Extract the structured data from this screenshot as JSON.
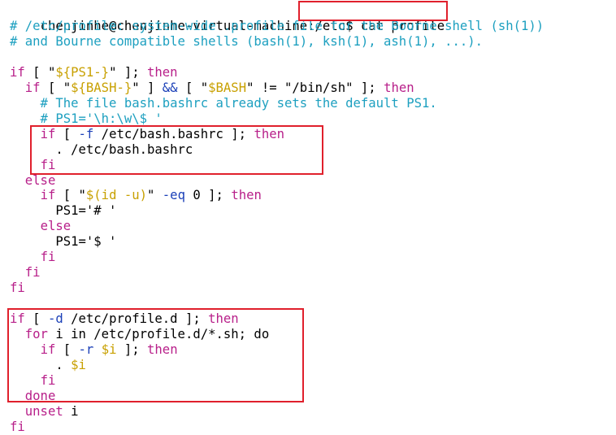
{
  "terminal": {
    "prompt": "chenjinhe@chenjinhe-virtual-machine:",
    "command": "/etc$ cat profile",
    "lines": [
      [
        {
          "t": "# /etc/profile: system-wide .profile file for the Bourne shell (sh(1))",
          "c": "cmt"
        }
      ],
      [
        {
          "t": "# and Bourne compatible shells (bash(1), ksh(1), ash(1), ...).",
          "c": "cmt"
        }
      ],
      [],
      [
        {
          "t": "if",
          "c": "kw"
        },
        {
          "t": " [ \"",
          "c": "txt"
        },
        {
          "t": "${PS1-}",
          "c": "var"
        },
        {
          "t": "\" ]; ",
          "c": "txt"
        },
        {
          "t": "then",
          "c": "kw"
        }
      ],
      [
        {
          "t": "  ",
          "c": "txt"
        },
        {
          "t": "if",
          "c": "kw"
        },
        {
          "t": " [ \"",
          "c": "txt"
        },
        {
          "t": "${BASH-}",
          "c": "var"
        },
        {
          "t": "\" ] ",
          "c": "txt"
        },
        {
          "t": "&&",
          "c": "op"
        },
        {
          "t": " [ \"",
          "c": "txt"
        },
        {
          "t": "$BASH",
          "c": "var"
        },
        {
          "t": "\" != \"/bin/sh\" ]; ",
          "c": "txt"
        },
        {
          "t": "then",
          "c": "kw"
        }
      ],
      [
        {
          "t": "    # The file bash.bashrc already sets the default PS1.",
          "c": "cmt"
        }
      ],
      [
        {
          "t": "    # PS1='\\h:\\w\\$ '",
          "c": "cmt"
        }
      ],
      [
        {
          "t": "    ",
          "c": "txt"
        },
        {
          "t": "if",
          "c": "kw"
        },
        {
          "t": " [ ",
          "c": "txt"
        },
        {
          "t": "-f",
          "c": "op"
        },
        {
          "t": " /etc/bash.bashrc ]; ",
          "c": "txt"
        },
        {
          "t": "then",
          "c": "kw"
        }
      ],
      [
        {
          "t": "      . /etc/bash.bashrc",
          "c": "txt"
        }
      ],
      [
        {
          "t": "    ",
          "c": "txt"
        },
        {
          "t": "fi",
          "c": "kw"
        }
      ],
      [
        {
          "t": "  ",
          "c": "txt"
        },
        {
          "t": "else",
          "c": "kw"
        }
      ],
      [
        {
          "t": "    ",
          "c": "txt"
        },
        {
          "t": "if",
          "c": "kw"
        },
        {
          "t": " [ \"",
          "c": "txt"
        },
        {
          "t": "$(id -u)",
          "c": "var"
        },
        {
          "t": "\" ",
          "c": "txt"
        },
        {
          "t": "-eq",
          "c": "op"
        },
        {
          "t": " 0 ]; ",
          "c": "txt"
        },
        {
          "t": "then",
          "c": "kw"
        }
      ],
      [
        {
          "t": "      PS1='# '",
          "c": "txt"
        }
      ],
      [
        {
          "t": "    ",
          "c": "txt"
        },
        {
          "t": "else",
          "c": "kw"
        }
      ],
      [
        {
          "t": "      PS1='$ '",
          "c": "txt"
        }
      ],
      [
        {
          "t": "    ",
          "c": "txt"
        },
        {
          "t": "fi",
          "c": "kw"
        }
      ],
      [
        {
          "t": "  ",
          "c": "txt"
        },
        {
          "t": "fi",
          "c": "kw"
        }
      ],
      [
        {
          "t": "fi",
          "c": "kw"
        }
      ],
      [],
      [
        {
          "t": "if",
          "c": "kw"
        },
        {
          "t": " [ ",
          "c": "txt"
        },
        {
          "t": "-d",
          "c": "op"
        },
        {
          "t": " /etc/profile.d ]; ",
          "c": "txt"
        },
        {
          "t": "then",
          "c": "kw"
        }
      ],
      [
        {
          "t": "  ",
          "c": "txt"
        },
        {
          "t": "for",
          "c": "kw"
        },
        {
          "t": " i in /etc/profile.d/*.sh; do",
          "c": "txt"
        }
      ],
      [
        {
          "t": "    ",
          "c": "txt"
        },
        {
          "t": "if",
          "c": "kw"
        },
        {
          "t": " [ ",
          "c": "txt"
        },
        {
          "t": "-r",
          "c": "op"
        },
        {
          "t": " ",
          "c": "txt"
        },
        {
          "t": "$i",
          "c": "var"
        },
        {
          "t": " ]; ",
          "c": "txt"
        },
        {
          "t": "then",
          "c": "kw"
        }
      ],
      [
        {
          "t": "      . ",
          "c": "txt"
        },
        {
          "t": "$i",
          "c": "var"
        }
      ],
      [
        {
          "t": "    ",
          "c": "txt"
        },
        {
          "t": "fi",
          "c": "kw"
        }
      ],
      [
        {
          "t": "  ",
          "c": "txt"
        },
        {
          "t": "done",
          "c": "kw"
        }
      ],
      [
        {
          "t": "  ",
          "c": "txt"
        },
        {
          "t": "unset",
          "c": "kw"
        },
        {
          "t": " i",
          "c": "txt"
        }
      ],
      [
        {
          "t": "fi",
          "c": "kw"
        }
      ]
    ]
  },
  "colors": {
    "background": "#ffffff",
    "comment": "#1ea0c0",
    "keyword": "#b8208a",
    "variable": "#c8a000",
    "operator": "#1b40b8",
    "highlight_box": "#e0202c"
  }
}
